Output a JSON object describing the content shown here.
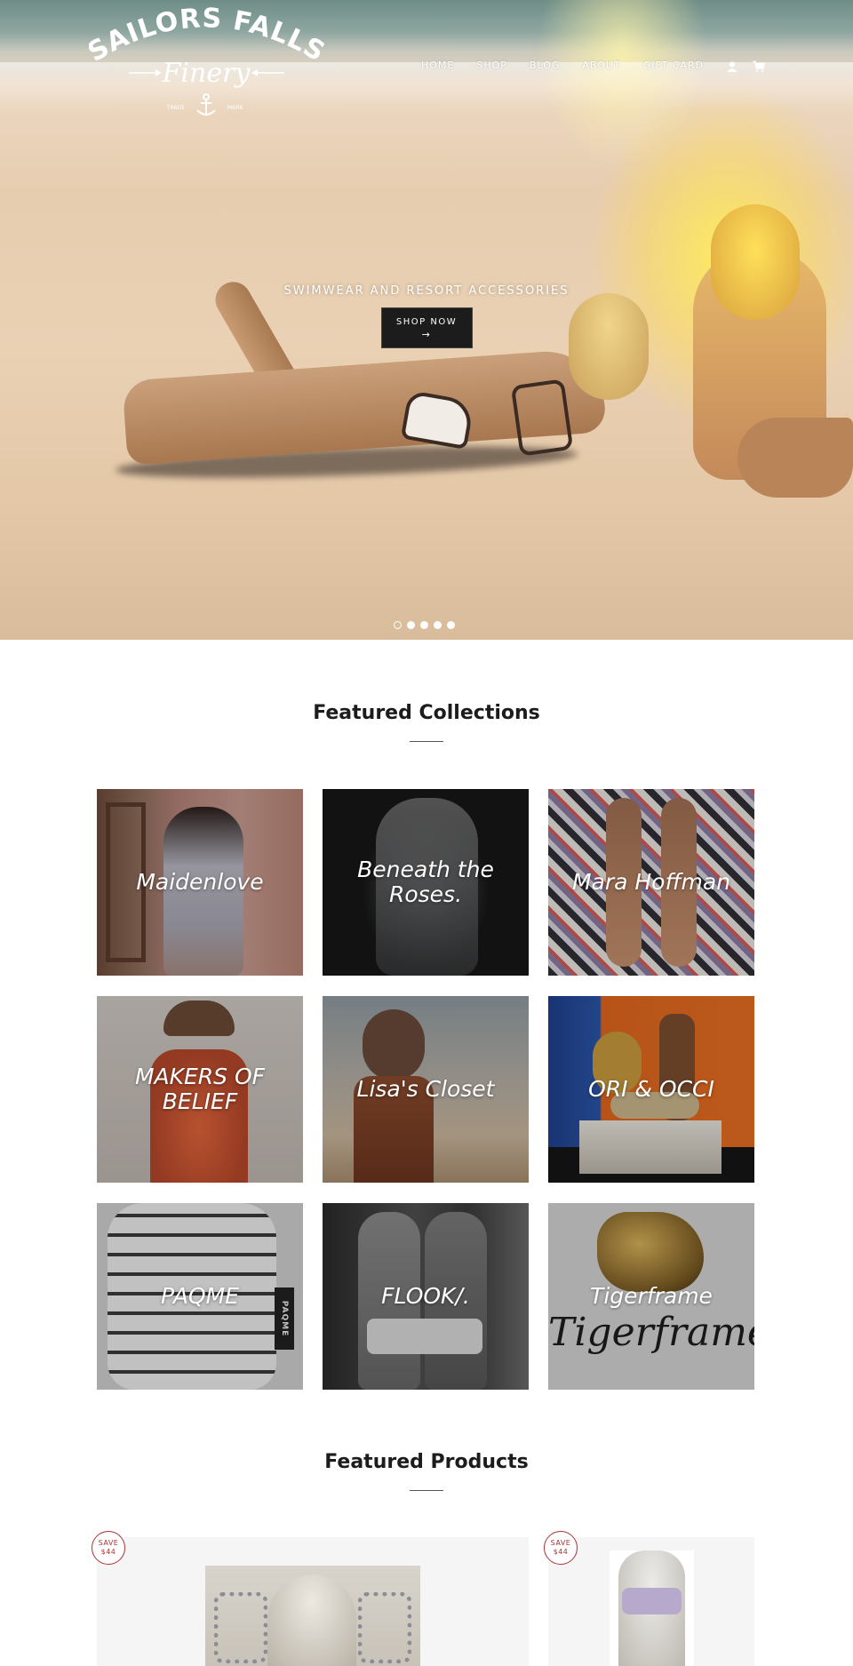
{
  "brand": {
    "name_line1": "SAILORS FALLS",
    "name_line2": "Finery",
    "trade": "TRADE",
    "mark": "MARK"
  },
  "nav": {
    "items": [
      {
        "label": "HOME"
      },
      {
        "label": "SHOP"
      },
      {
        "label": "BLOG"
      },
      {
        "label": "ABOUT"
      },
      {
        "label": "GIFT CARD"
      }
    ],
    "account_icon": "user-icon",
    "cart_icon": "cart-icon"
  },
  "hero": {
    "tagline": "SWIMWEAR AND RESORT ACCESSORIES",
    "button_label": "SHOP NOW",
    "button_arrow": "→",
    "slide_count": 5,
    "active_slide": 1
  },
  "featured_collections": {
    "title": "Featured Collections",
    "items": [
      {
        "name": "Maidenlove"
      },
      {
        "name": "Beneath the Roses."
      },
      {
        "name": "Mara Hoffman"
      },
      {
        "name": "MAKERS OF BELIEF"
      },
      {
        "name": "Lisa's Closet"
      },
      {
        "name": "ORI & OCCI"
      },
      {
        "name": "PAQME"
      },
      {
        "name": "FLOOK/."
      },
      {
        "name": "Tigerframe"
      }
    ],
    "tigerframe_script": "Tigerframe",
    "paqme_tag": "PAQME"
  },
  "featured_products": {
    "title": "Featured Products",
    "items": [
      {
        "save_label": "SAVE",
        "save_amount": "$44"
      },
      {
        "save_label": "SAVE",
        "save_amount": "$44"
      }
    ]
  }
}
